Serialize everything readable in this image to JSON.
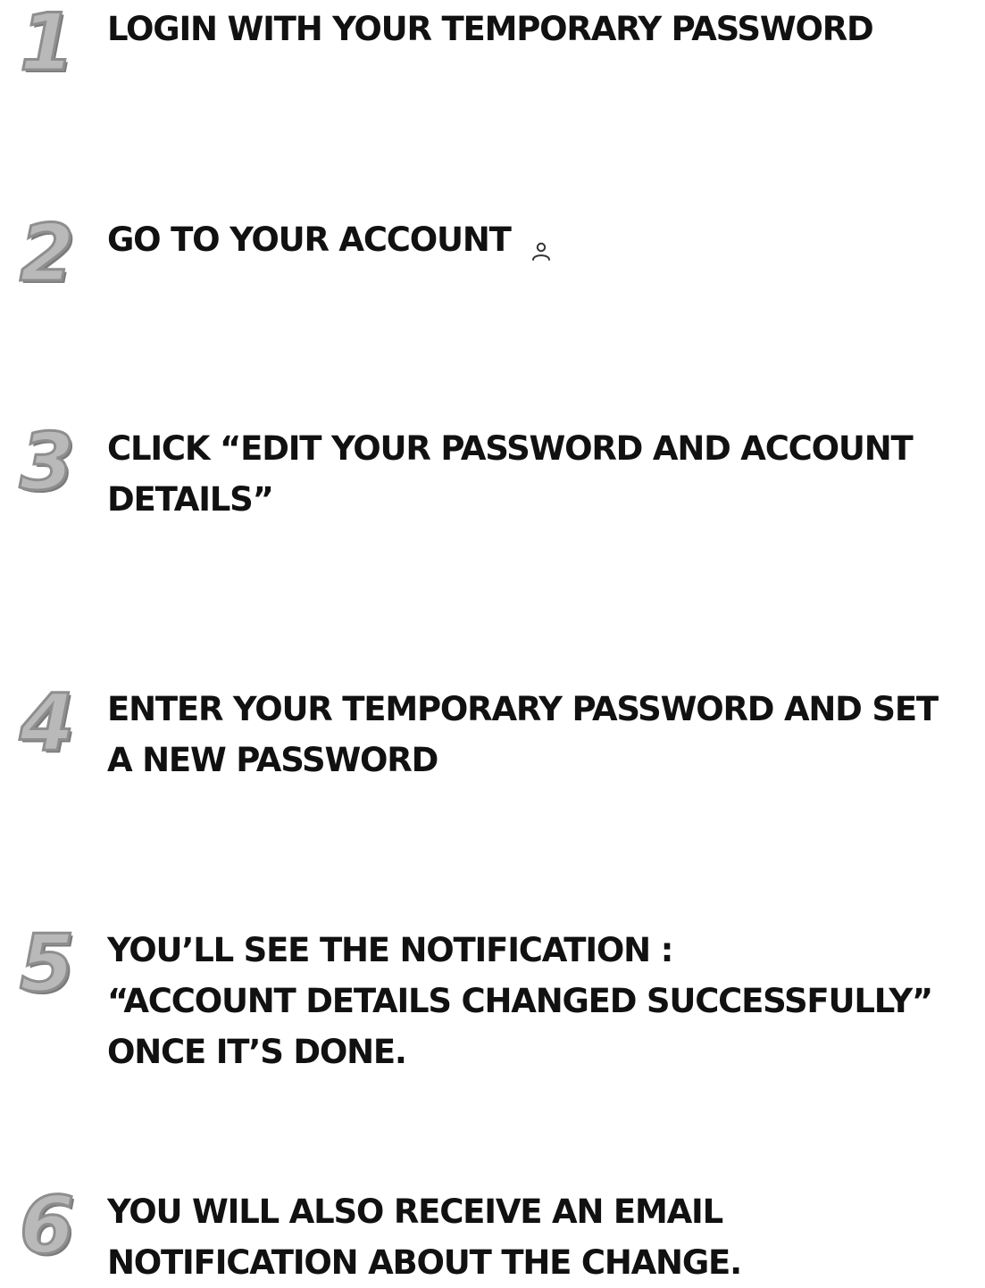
{
  "steps": [
    {
      "number": "1",
      "lines": [
        "LOGIN WITH YOUR TEMPORARY PASSWORD"
      ]
    },
    {
      "number": "2",
      "lines": [
        "GO TO YOUR ACCOUNT"
      ],
      "icon": "user-account-icon"
    },
    {
      "number": "3",
      "lines": [
        "CLICK “EDIT YOUR PASSWORD AND ACCOUNT",
        "DETAILS”"
      ]
    },
    {
      "number": "4",
      "lines": [
        "ENTER YOUR TEMPORARY PASSWORD AND SET",
        "A NEW PASSWORD"
      ]
    },
    {
      "number": "5",
      "lines": [
        "YOU’LL SEE THE NOTIFICATION :",
        "“ACCOUNT DETAILS CHANGED SUCCESSFULLY”",
        "ONCE IT’S DONE."
      ]
    },
    {
      "number": "6",
      "lines": [
        "YOU WILL ALSO RECEIVE AN EMAIL",
        "NOTIFICATION ABOUT THE CHANGE."
      ]
    }
  ],
  "colors": {
    "text": "#111111",
    "number_fill": "#b9b9b9",
    "number_stroke": "#8e8e8e"
  }
}
